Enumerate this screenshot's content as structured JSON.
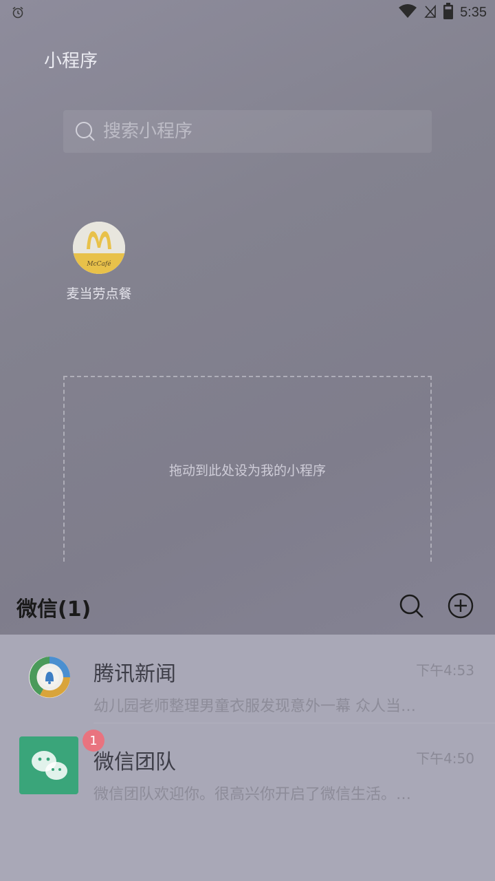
{
  "status_bar": {
    "time": "5:35",
    "icons": [
      "alarm-icon",
      "wifi-icon",
      "signal-off-icon",
      "battery-icon"
    ]
  },
  "mini_programs": {
    "title": "小程序",
    "search_placeholder": "搜索小程序",
    "apps": [
      {
        "label": "麦当劳点餐",
        "icon": "mcdonalds-mccafe-icon"
      }
    ],
    "drop_zone_text": "拖动到此处设为我的小程序"
  },
  "wechat": {
    "title": "微信(1)",
    "chats": [
      {
        "name": "腾讯新闻",
        "time": "下午4:53",
        "preview": "幼儿园老师整理男童衣服发现意外一幕 众人当…",
        "avatar": "tencent-news-icon"
      },
      {
        "name": "微信团队",
        "time": "下午4:50",
        "preview": "微信团队欢迎你。很高兴你开启了微信生活。…",
        "avatar": "wechat-team-icon",
        "badge": "1"
      }
    ]
  },
  "colors": {
    "mccafe_yellow": "#e8c14a",
    "wechat_green": "#3aa57a",
    "badge_red": "#e9737f"
  }
}
